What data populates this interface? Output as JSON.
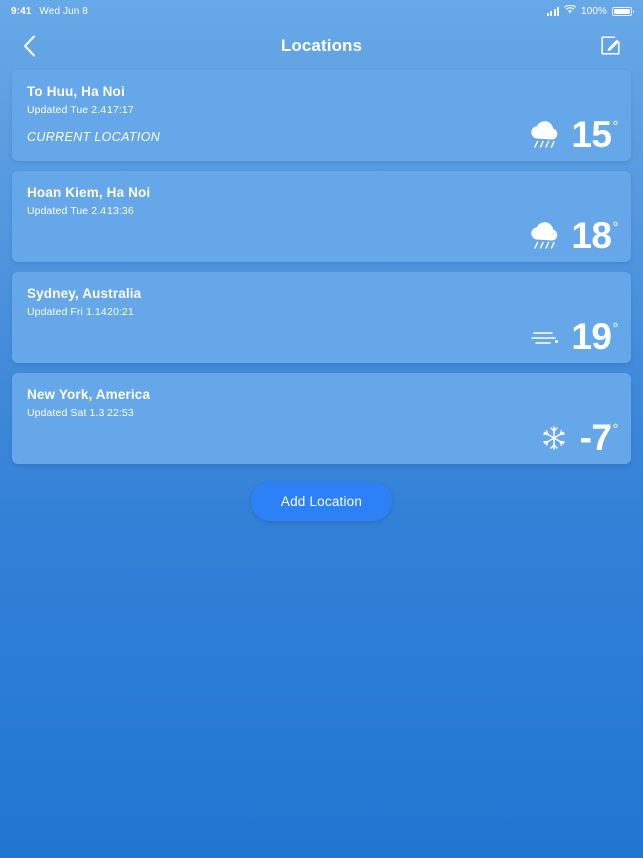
{
  "status_bar": {
    "time": "9:41",
    "date": "Wed Jun 8",
    "battery_percent": "100%",
    "icons": {
      "signal": "cellular-signal-icon",
      "wifi": "wifi-icon",
      "battery": "battery-icon"
    }
  },
  "header": {
    "back_icon": "chevron-left-icon",
    "title": "Locations",
    "edit_icon": "edit-pencil-icon"
  },
  "locations": [
    {
      "city": "To Huu, Ha Noi",
      "updated_label": "Updated Tue 2.4",
      "updated_time": "17:17",
      "badge": "CURRENT LOCATION",
      "weather_icon": "rain-cloud-icon",
      "temperature": "15",
      "degree": "°"
    },
    {
      "city": "Hoan Kiem, Ha Noi",
      "updated_label": "Updated Tue 2.4",
      "updated_time": "13:36",
      "badge": "",
      "weather_icon": "rain-cloud-icon",
      "temperature": "18",
      "degree": "°"
    },
    {
      "city": "Sydney, Australia",
      "updated_label": "Updated Fri 1.14",
      "updated_time": "20:21",
      "badge": "",
      "weather_icon": "wind-lines-icon",
      "temperature": "19",
      "degree": "°"
    },
    {
      "city": "New York, America",
      "updated_label": "Updated Sat 1.3",
      "updated_time": "22:53",
      "badge": "",
      "weather_icon": "snowflake-icon",
      "temperature": "-7",
      "degree": "°"
    }
  ],
  "add_button": {
    "label": "Add Location"
  },
  "colors": {
    "background_top": "#66a8e8",
    "background_bottom": "#2076d1",
    "card": "#65a7e8",
    "accent_button": "#2d81f6",
    "text": "#ffffff"
  }
}
